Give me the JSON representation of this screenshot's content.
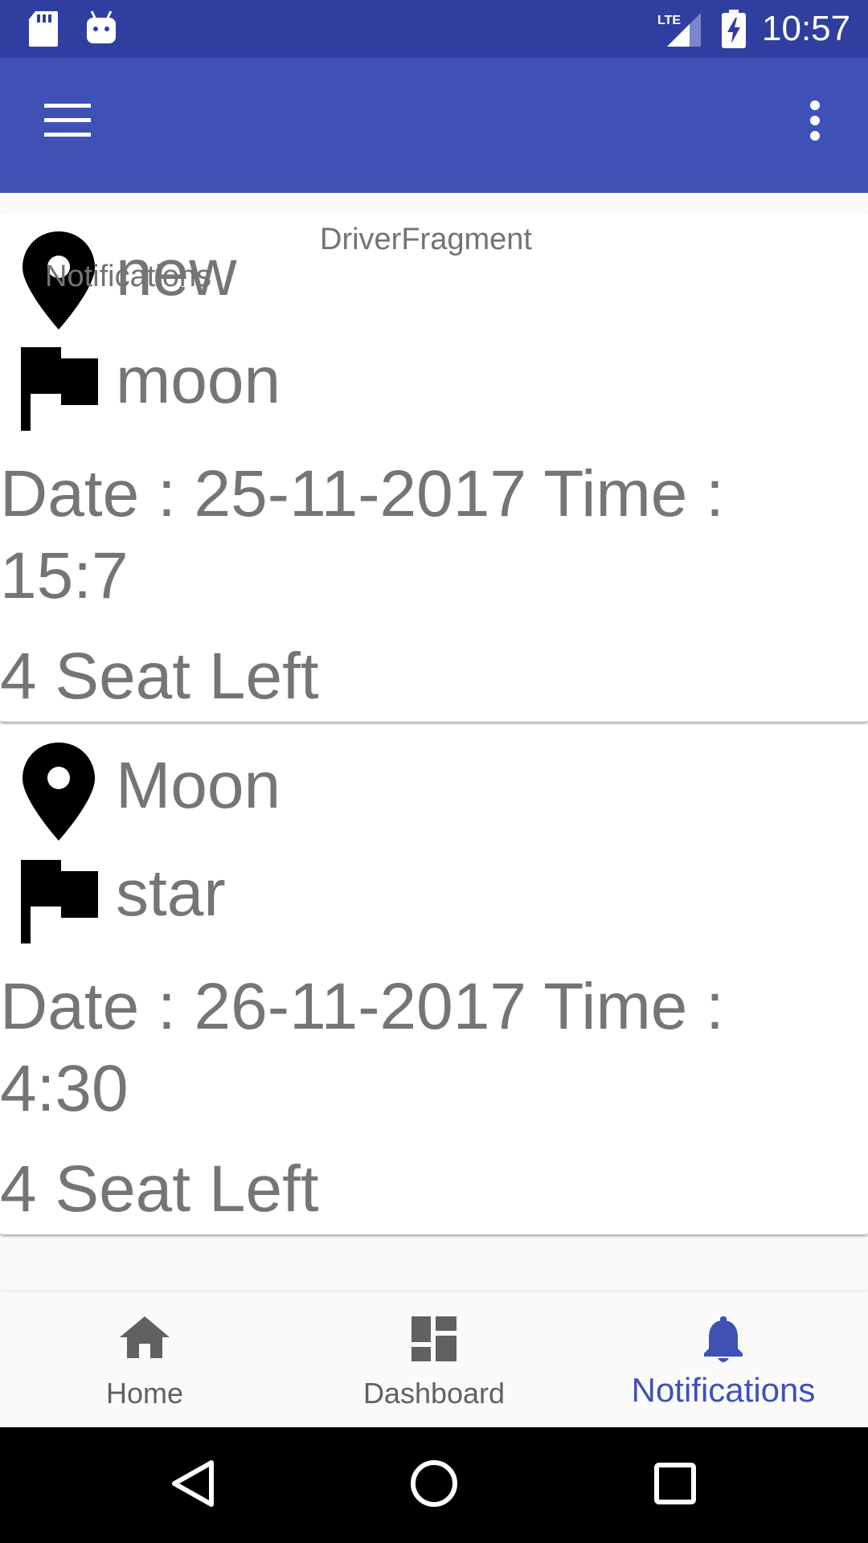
{
  "status_bar": {
    "time": "10:57",
    "icons": [
      "sd-card-icon",
      "android-icon",
      "lte-signal-icon",
      "battery-charging-icon"
    ]
  },
  "app_bar": {
    "menu_icon": "hamburger-menu-icon",
    "overflow_icon": "more-vert-icon",
    "background_color": "#3f51b5"
  },
  "content": {
    "fragment_label": "DriverFragment",
    "notifications_text": "Notifications",
    "rides": [
      {
        "from": "new",
        "to": "moon",
        "datetime": "Date : 25-11-2017 Time : 15:7",
        "seats": "4 Seat Left"
      },
      {
        "from": "Moon",
        "to": "star",
        "datetime": "Date : 26-11-2017 Time : 4:30",
        "seats": "4 Seat Left"
      }
    ]
  },
  "bottom_nav": {
    "items": [
      {
        "label": "Home",
        "icon": "home-icon"
      },
      {
        "label": "Dashboard",
        "icon": "dashboard-icon"
      },
      {
        "label": "Notifications",
        "icon": "bell-icon",
        "active": true
      }
    ],
    "active_color": "#3f51b5",
    "inactive_color": "#616161"
  },
  "system_nav": {
    "buttons": [
      "back-icon",
      "home-circle-icon",
      "recents-icon"
    ]
  }
}
